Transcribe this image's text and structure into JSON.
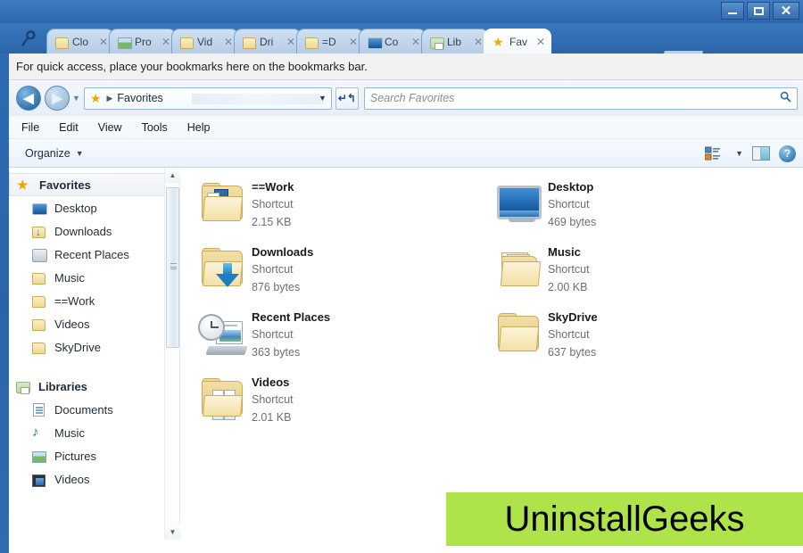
{
  "window": {
    "minimize_label": "Minimize",
    "maximize_label": "Restore",
    "close_label": "✕"
  },
  "browser": {
    "wrench_label": "⚒",
    "tabs": [
      {
        "label": "Clo",
        "close": "✕",
        "icon": "folder-icon",
        "active": false
      },
      {
        "label": "Pro",
        "close": "✕",
        "icon": "program-icon",
        "active": false
      },
      {
        "label": "Vid",
        "close": "✕",
        "icon": "folder-icon",
        "active": false
      },
      {
        "label": "Dri",
        "close": "✕",
        "icon": "folder-icon",
        "active": false
      },
      {
        "label": "=D",
        "close": "✕",
        "icon": "folder-icon",
        "active": false
      },
      {
        "label": "Co",
        "close": "✕",
        "icon": "computer-icon",
        "active": false
      },
      {
        "label": "Lib",
        "close": "✕",
        "icon": "libraries-icon",
        "active": false
      },
      {
        "label": "Fav",
        "close": "✕",
        "icon": "star-icon",
        "active": true
      }
    ],
    "bookmarks_bar_text": "For quick access, place your bookmarks here on the bookmarks bar."
  },
  "address": {
    "back_label": "◀",
    "forward_label": "▶",
    "history_caret": "▼",
    "star_icon": "star-icon",
    "separator": "▶",
    "crumb": "Favorites",
    "dropdown_caret": "▼",
    "refresh_label": "↵↰"
  },
  "search": {
    "placeholder": "Search Favorites",
    "icon": "magnifier-icon"
  },
  "menu": {
    "items": [
      "File",
      "Edit",
      "View",
      "Tools",
      "Help"
    ]
  },
  "toolbar": {
    "organize_label": "Organize",
    "organize_caret": "▼",
    "views_caret": "▼",
    "help_label": "?"
  },
  "navpane": {
    "groups": [
      {
        "header": {
          "label": "Favorites",
          "icon": "star-icon",
          "selected": true
        },
        "items": [
          {
            "label": "Desktop",
            "icon": "monitor-icon"
          },
          {
            "label": "Downloads",
            "icon": "folder-download-icon"
          },
          {
            "label": "Recent Places",
            "icon": "recent-places-icon"
          },
          {
            "label": "Music",
            "icon": "folder-icon"
          },
          {
            "label": "==Work",
            "icon": "folder-icon"
          },
          {
            "label": "Videos",
            "icon": "folder-icon"
          },
          {
            "label": "SkyDrive",
            "icon": "folder-icon"
          }
        ]
      },
      {
        "header": {
          "label": "Libraries",
          "icon": "libraries-icon",
          "selected": false
        },
        "items": [
          {
            "label": "Documents",
            "icon": "document-icon"
          },
          {
            "label": "Music",
            "icon": "music-note-icon"
          },
          {
            "label": "Pictures",
            "icon": "picture-icon"
          },
          {
            "label": "Videos",
            "icon": "film-icon"
          }
        ]
      }
    ],
    "scroll_up": "▲",
    "scroll_down": "▼"
  },
  "files": [
    {
      "name": "==Work",
      "type": "Shortcut",
      "size": "2.15 KB",
      "icon": "folder-work-icon"
    },
    {
      "name": "Desktop",
      "type": "Shortcut",
      "size": "469 bytes",
      "icon": "monitor-icon"
    },
    {
      "name": "Downloads",
      "type": "Shortcut",
      "size": "876 bytes",
      "icon": "folder-download-icon"
    },
    {
      "name": "Music",
      "type": "Shortcut",
      "size": "2.00 KB",
      "icon": "folder-music-icon"
    },
    {
      "name": "Recent Places",
      "type": "Shortcut",
      "size": "363 bytes",
      "icon": "recent-places-icon"
    },
    {
      "name": "SkyDrive",
      "type": "Shortcut",
      "size": "637 bytes",
      "icon": "folder-icon"
    },
    {
      "name": "Videos",
      "type": "Shortcut",
      "size": "2.01 KB",
      "icon": "folder-video-icon"
    }
  ],
  "watermark": {
    "text": "UninstallGeeks",
    "background": "#aee34a"
  },
  "colors": {
    "chrome_blue": "#2d67ab",
    "accent": "#1b7fc4",
    "folder_yellow": "#eed88f"
  }
}
